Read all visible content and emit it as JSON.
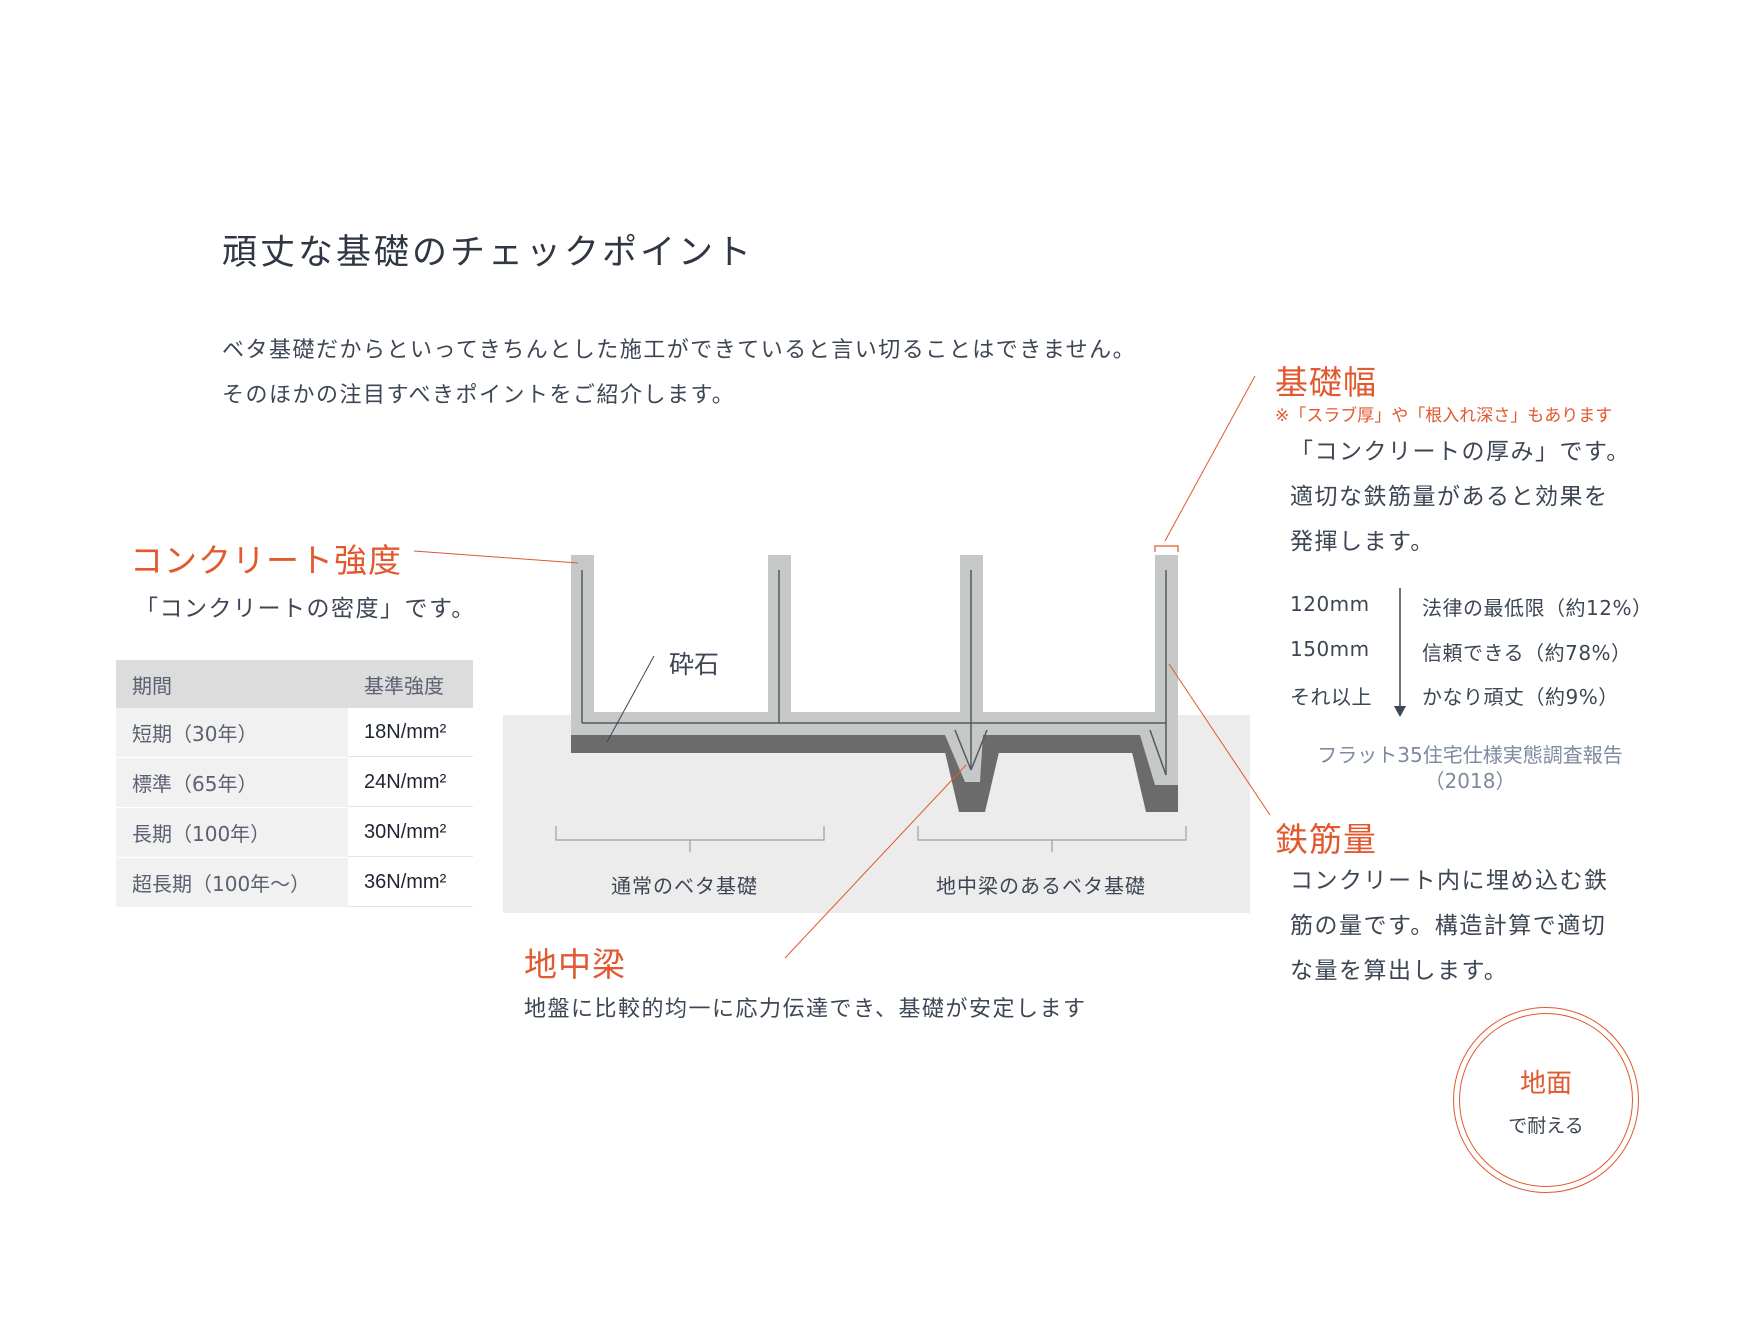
{
  "header": {
    "title": "頑丈な基礎のチェックポイント",
    "intro_line1": "ベタ基礎だからといってきちんとした施工ができていると言い切ることはできません。",
    "intro_line2": "そのほかの注目すべきポイントをご紹介します。"
  },
  "concrete_strength": {
    "heading": "コンクリート強度",
    "description": "「コンクリートの密度」です。",
    "table": {
      "headers": [
        "期間",
        "基準強度"
      ],
      "rows": [
        {
          "period": "短期（30年）",
          "value": "18N/mm²"
        },
        {
          "period": "標準（65年）",
          "value": "24N/mm²"
        },
        {
          "period": "長期（100年）",
          "value": "30N/mm²"
        },
        {
          "period": "超長期（100年〜）",
          "value": "36N/mm²"
        }
      ]
    }
  },
  "diagram": {
    "gravel_label": "砕石",
    "normal_label": "通常のベタ基礎",
    "beam_label": "地中梁のあるベタ基礎"
  },
  "ground_beam": {
    "heading": "地中梁",
    "description": "地盤に比較的均一に応力伝達でき、基礎が安定します"
  },
  "foundation_width": {
    "heading": "基礎幅",
    "note": "※「スラブ厚」や「根入れ深さ」もあります",
    "desc_line1": "「コンクリートの厚み」です。",
    "desc_line2": "適切な鉄筋量があると効果を",
    "desc_line3": "発揮します。",
    "stats": [
      {
        "size": "120mm",
        "label": "法律の最低限（約12%）"
      },
      {
        "size": "150mm",
        "label": "信頼できる（約78%）"
      },
      {
        "size": "それ以上",
        "label": "かなり頑丈（約9%）"
      }
    ],
    "source_line1": "フラット35住宅仕様実態調査報告",
    "source_line2": "（2018）"
  },
  "rebar": {
    "heading": "鉄筋量",
    "desc_line1": "コンクリート内に埋め込む鉄",
    "desc_line2": "筋の量です。構造計算で適切",
    "desc_line3": "な量を算出します。"
  },
  "stamp": {
    "main": "地面",
    "sub": "で耐える"
  },
  "colors": {
    "accent": "#e2582f",
    "text": "#3d4654",
    "ground": "#ececec",
    "concrete": "#c6c8c8",
    "gravel": "#6b6b6b"
  }
}
